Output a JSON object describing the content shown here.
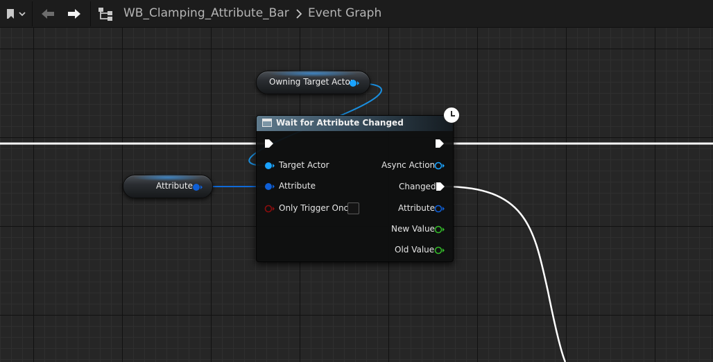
{
  "toolbar": {
    "breadcrumb_asset": "WB_Clamping_Attribute_Bar",
    "breadcrumb_graph": "Event Graph",
    "icons": [
      "bookmark-icon",
      "chevron-down-icon",
      "back-arrow-icon",
      "forward-arrow-icon",
      "hierarchy-icon",
      "chevron-right-icon"
    ]
  },
  "nodes": {
    "owning_target_actor": {
      "label": "Owning Target Actor"
    },
    "attribute_var": {
      "label": "Attribute"
    },
    "wait_node": {
      "title": "Wait for Attribute Changed",
      "inputs": [
        "Target Actor",
        "Attribute",
        "Only Trigger Once"
      ],
      "outputs": [
        "Async Action",
        "Changed",
        "Attribute",
        "New Value",
        "Old Value"
      ],
      "only_trigger_once_checked": false
    }
  },
  "colors": {
    "object_pin": "#1aa3ff",
    "struct_pin": "#0f5fd6",
    "bool_pin": "#8c0d0d",
    "float_pin": "#34b82a",
    "exec_wire": "#ffffff",
    "header": "#5f7a8c"
  }
}
